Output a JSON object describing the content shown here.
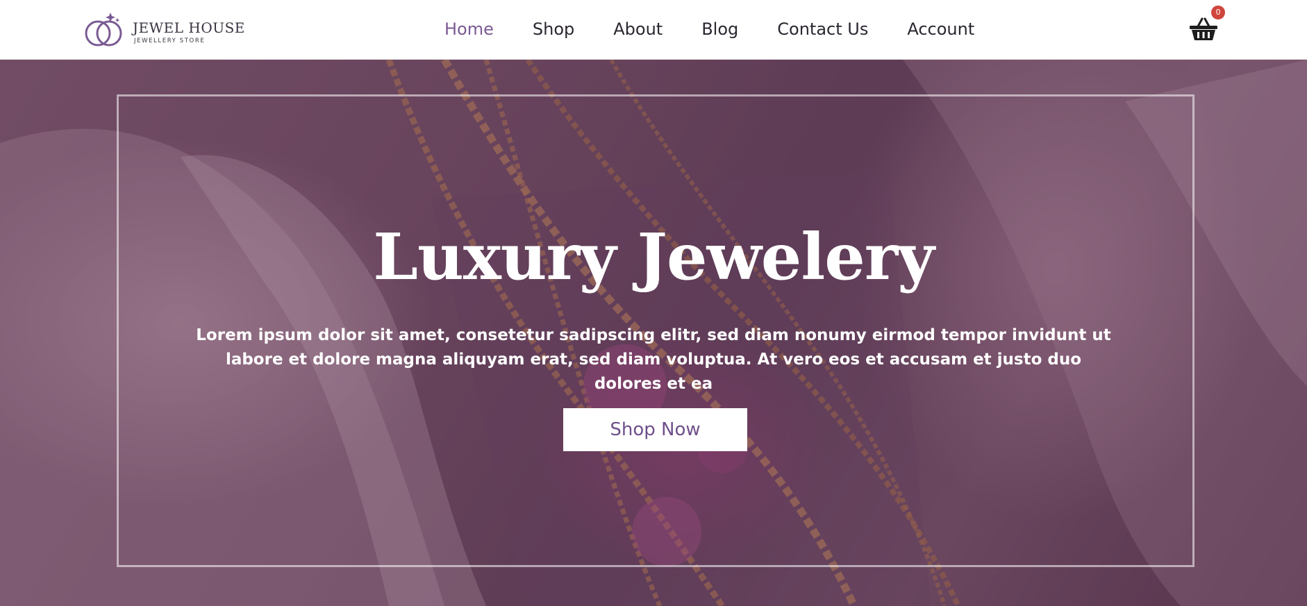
{
  "brand": {
    "name": "JEWEL HOUSE",
    "tagline": "JEWELLERY STORE",
    "logo_icon": "interlocked-rings-icon",
    "accent_color": "#7a5a93"
  },
  "nav": {
    "items": [
      {
        "label": "Home",
        "active": true
      },
      {
        "label": "Shop",
        "active": false
      },
      {
        "label": "About",
        "active": false
      },
      {
        "label": "Blog",
        "active": false
      },
      {
        "label": "Contact Us",
        "active": false
      },
      {
        "label": "Account",
        "active": false
      }
    ]
  },
  "cart": {
    "icon": "basket-icon",
    "count": "0",
    "badge_color": "#d0463d"
  },
  "hero": {
    "title": "Luxury Jewelery",
    "text": "Lorem ipsum dolor sit amet, consetetur sadipscing elitr, sed diam nonumy eirmod tempor invidunt ut labore et dolore magna aliquyam erat, sed diam voluptua. At vero eos et accusam et justo duo dolores et ea",
    "button_label": "Shop Now",
    "background": "gold chains on mauve fabric"
  }
}
